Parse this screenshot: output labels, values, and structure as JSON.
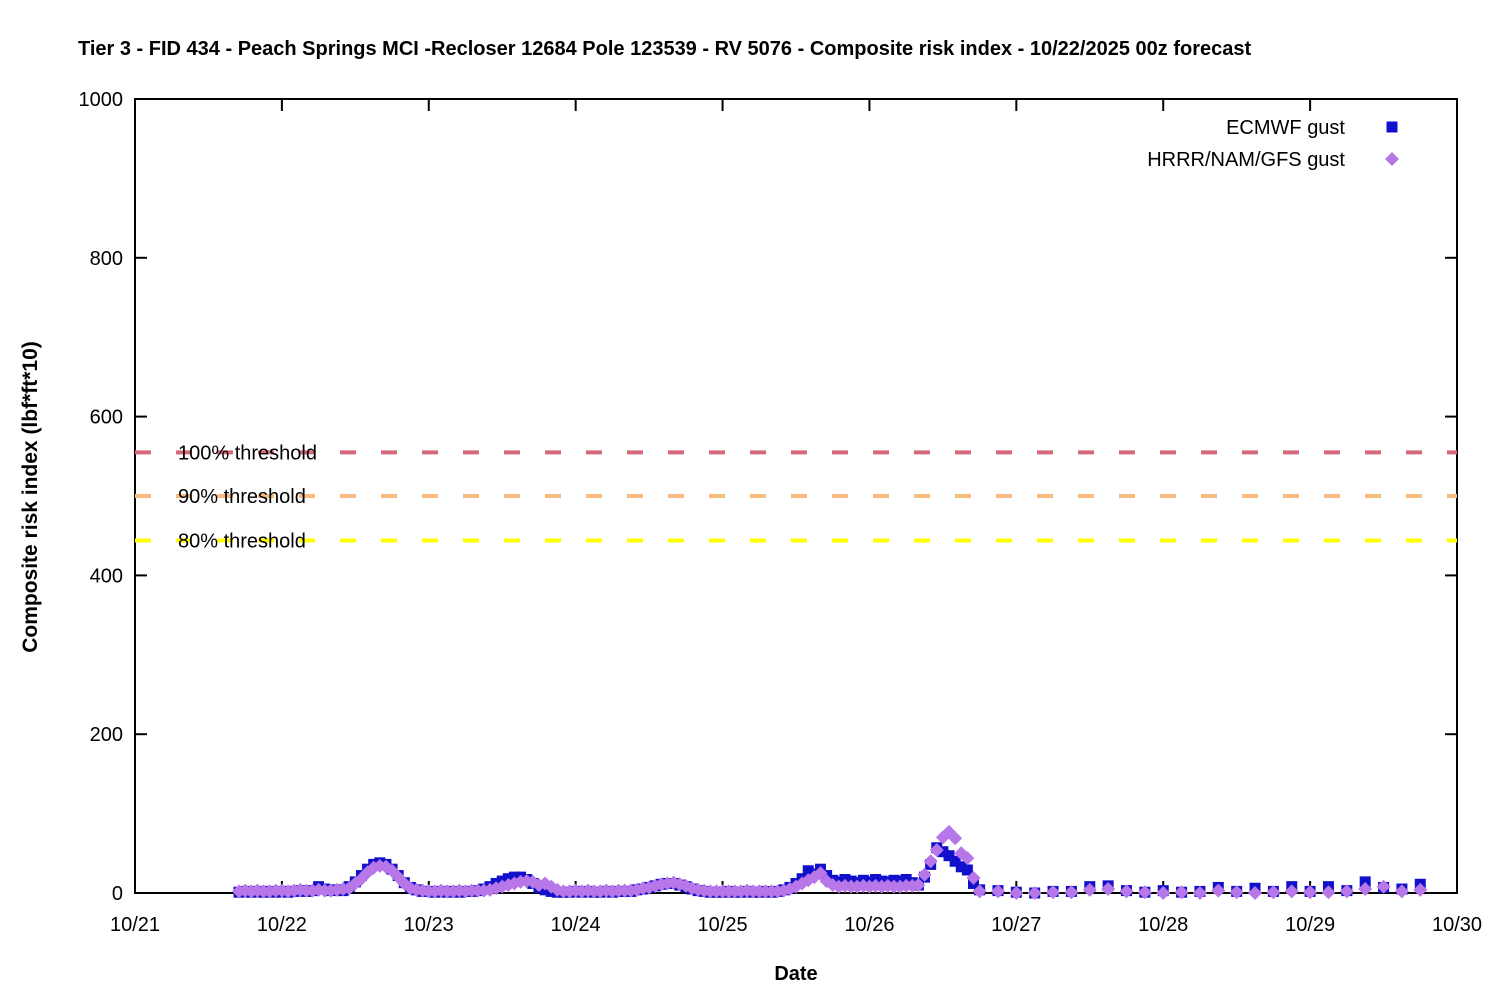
{
  "title": "Tier 3 - FID 434 - Peach Springs MCI -Recloser 12684 Pole 123539 - RV 5076 - Composite risk index - 10/22/2025 00z forecast",
  "chart_data": {
    "type": "scatter",
    "title": "Tier 3 - FID 434 - Peach Springs MCI -Recloser 12684 Pole 123539 - RV 5076 - Composite risk index - 10/22/2025 00z forecast",
    "xlabel": "Date",
    "ylabel": "Composite risk index (lbf*ft*10)",
    "x_tick_labels": [
      "10/21",
      "10/22",
      "10/23",
      "10/24",
      "10/25",
      "10/26",
      "10/27",
      "10/28",
      "10/29",
      "10/30"
    ],
    "x_range_days": 9,
    "x_unit": "point x = hours after 10/21 00:00",
    "ylim": [
      0,
      1000
    ],
    "y_ticks": [
      0,
      200,
      400,
      600,
      800,
      1000
    ],
    "grid": "off",
    "legend_position": "top-right-inside",
    "thresholds": [
      {
        "label": "100% threshold",
        "value": 555,
        "color": "#d4697c"
      },
      {
        "label": "90% threshold",
        "value": 500,
        "color": "#f9bc80"
      },
      {
        "label": "80% threshold",
        "value": 444,
        "color": "#ffff00"
      }
    ],
    "series": [
      {
        "name": "ECMWF gust",
        "marker": "square",
        "color": "#1111cc",
        "points": [
          [
            17,
            1
          ],
          [
            18,
            2
          ],
          [
            19,
            1
          ],
          [
            20,
            2
          ],
          [
            21,
            1
          ],
          [
            22,
            2
          ],
          [
            23,
            1
          ],
          [
            24,
            2
          ],
          [
            25,
            1
          ],
          [
            26,
            2
          ],
          [
            27,
            3
          ],
          [
            28,
            2
          ],
          [
            29,
            3
          ],
          [
            30,
            8
          ],
          [
            31,
            5
          ],
          [
            32,
            3
          ],
          [
            33,
            4
          ],
          [
            34,
            3
          ],
          [
            35,
            8
          ],
          [
            36,
            14
          ],
          [
            37,
            22
          ],
          [
            38,
            30
          ],
          [
            39,
            36
          ],
          [
            40,
            38
          ],
          [
            41,
            36
          ],
          [
            42,
            30
          ],
          [
            43,
            22
          ],
          [
            44,
            13
          ],
          [
            45,
            7
          ],
          [
            46,
            4
          ],
          [
            47,
            2
          ],
          [
            48,
            2
          ],
          [
            49,
            1
          ],
          [
            50,
            2
          ],
          [
            51,
            1
          ],
          [
            52,
            2
          ],
          [
            53,
            1
          ],
          [
            54,
            2
          ],
          [
            55,
            2
          ],
          [
            56,
            3
          ],
          [
            57,
            5
          ],
          [
            58,
            8
          ],
          [
            59,
            12
          ],
          [
            60,
            15
          ],
          [
            61,
            18
          ],
          [
            62,
            20
          ],
          [
            63,
            20
          ],
          [
            64,
            17
          ],
          [
            65,
            12
          ],
          [
            66,
            7
          ],
          [
            67,
            4
          ],
          [
            68,
            2
          ],
          [
            69,
            1
          ],
          [
            70,
            1
          ],
          [
            71,
            1
          ],
          [
            72,
            2
          ],
          [
            73,
            1
          ],
          [
            74,
            2
          ],
          [
            75,
            1
          ],
          [
            76,
            1
          ],
          [
            77,
            2
          ],
          [
            78,
            1
          ],
          [
            79,
            2
          ],
          [
            80,
            2
          ],
          [
            81,
            2
          ],
          [
            82,
            4
          ],
          [
            83,
            5
          ],
          [
            84,
            7
          ],
          [
            85,
            9
          ],
          [
            86,
            11
          ],
          [
            87,
            12
          ],
          [
            88,
            12
          ],
          [
            89,
            10
          ],
          [
            90,
            8
          ],
          [
            91,
            5
          ],
          [
            92,
            3
          ],
          [
            93,
            2
          ],
          [
            94,
            1
          ],
          [
            95,
            1
          ],
          [
            96,
            1
          ],
          [
            97,
            2
          ],
          [
            98,
            1
          ],
          [
            99,
            1
          ],
          [
            100,
            2
          ],
          [
            101,
            1
          ],
          [
            102,
            1
          ],
          [
            103,
            2
          ],
          [
            104,
            1
          ],
          [
            105,
            2
          ],
          [
            106,
            4
          ],
          [
            107,
            7
          ],
          [
            108,
            12
          ],
          [
            109,
            18
          ],
          [
            110,
            28
          ],
          [
            111,
            24
          ],
          [
            112,
            30
          ],
          [
            113,
            22
          ],
          [
            114,
            16
          ],
          [
            115,
            14
          ],
          [
            116,
            17
          ],
          [
            117,
            15
          ],
          [
            118,
            13
          ],
          [
            119,
            16
          ],
          [
            120,
            14
          ],
          [
            121,
            17
          ],
          [
            122,
            15
          ],
          [
            123,
            14
          ],
          [
            124,
            16
          ],
          [
            125,
            15
          ],
          [
            126,
            17
          ],
          [
            127,
            13
          ],
          [
            128,
            10
          ],
          [
            129,
            20
          ],
          [
            130,
            36
          ],
          [
            131,
            57
          ],
          [
            132,
            52
          ],
          [
            133,
            47
          ],
          [
            134,
            40
          ],
          [
            135,
            33
          ],
          [
            136,
            29
          ],
          [
            137,
            12
          ],
          [
            138,
            4
          ],
          [
            141,
            3
          ],
          [
            144,
            1
          ],
          [
            147,
            0
          ],
          [
            150,
            2
          ],
          [
            153,
            2
          ],
          [
            156,
            8
          ],
          [
            159,
            9
          ],
          [
            162,
            3
          ],
          [
            165,
            1
          ],
          [
            168,
            3
          ],
          [
            171,
            1
          ],
          [
            174,
            2
          ],
          [
            177,
            7
          ],
          [
            180,
            2
          ],
          [
            183,
            6
          ],
          [
            186,
            2
          ],
          [
            189,
            8
          ],
          [
            192,
            2
          ],
          [
            195,
            8
          ],
          [
            198,
            3
          ],
          [
            201,
            14
          ],
          [
            204,
            7
          ],
          [
            207,
            5
          ],
          [
            210,
            11
          ]
        ]
      },
      {
        "name": "HRRR/NAM/GFS gust",
        "marker": "diamond",
        "color": "#b877e8",
        "points": [
          [
            17,
            2
          ],
          [
            18,
            3
          ],
          [
            19,
            2
          ],
          [
            20,
            3
          ],
          [
            21,
            2
          ],
          [
            22,
            2
          ],
          [
            23,
            3
          ],
          [
            24,
            3
          ],
          [
            25,
            2
          ],
          [
            26,
            3
          ],
          [
            27,
            4
          ],
          [
            28,
            3
          ],
          [
            29,
            3
          ],
          [
            30,
            4
          ],
          [
            31,
            3
          ],
          [
            32,
            3
          ],
          [
            33,
            4
          ],
          [
            34,
            5
          ],
          [
            35,
            6
          ],
          [
            36,
            12
          ],
          [
            37,
            18
          ],
          [
            38,
            26
          ],
          [
            39,
            32
          ],
          [
            40,
            34
          ],
          [
            41,
            33
          ],
          [
            42,
            28
          ],
          [
            43,
            20
          ],
          [
            44,
            12
          ],
          [
            45,
            6
          ],
          [
            46,
            4
          ],
          [
            47,
            3
          ],
          [
            48,
            2
          ],
          [
            49,
            2
          ],
          [
            50,
            3
          ],
          [
            51,
            2
          ],
          [
            52,
            2
          ],
          [
            53,
            3
          ],
          [
            54,
            2
          ],
          [
            55,
            3
          ],
          [
            56,
            3
          ],
          [
            57,
            3
          ],
          [
            58,
            4
          ],
          [
            59,
            6
          ],
          [
            60,
            8
          ],
          [
            61,
            10
          ],
          [
            62,
            12
          ],
          [
            63,
            14
          ],
          [
            64,
            15
          ],
          [
            65,
            14
          ],
          [
            66,
            10
          ],
          [
            67,
            12
          ],
          [
            68,
            8
          ],
          [
            69,
            4
          ],
          [
            70,
            2
          ],
          [
            71,
            2
          ],
          [
            72,
            3
          ],
          [
            73,
            2
          ],
          [
            74,
            3
          ],
          [
            75,
            2
          ],
          [
            76,
            2
          ],
          [
            77,
            3
          ],
          [
            78,
            2
          ],
          [
            79,
            3
          ],
          [
            80,
            3
          ],
          [
            81,
            3
          ],
          [
            82,
            4
          ],
          [
            83,
            6
          ],
          [
            84,
            7
          ],
          [
            85,
            9
          ],
          [
            86,
            11
          ],
          [
            87,
            12
          ],
          [
            88,
            13
          ],
          [
            89,
            11
          ],
          [
            90,
            9
          ],
          [
            91,
            6
          ],
          [
            92,
            4
          ],
          [
            93,
            3
          ],
          [
            94,
            2
          ],
          [
            95,
            2
          ],
          [
            96,
            2
          ],
          [
            97,
            2
          ],
          [
            98,
            2
          ],
          [
            99,
            2
          ],
          [
            100,
            3
          ],
          [
            101,
            2
          ],
          [
            102,
            2
          ],
          [
            103,
            2
          ],
          [
            104,
            2
          ],
          [
            105,
            2
          ],
          [
            106,
            3
          ],
          [
            107,
            5
          ],
          [
            108,
            8
          ],
          [
            109,
            12
          ],
          [
            110,
            16
          ],
          [
            111,
            20
          ],
          [
            112,
            25
          ],
          [
            113,
            15
          ],
          [
            114,
            10
          ],
          [
            115,
            8
          ],
          [
            116,
            9
          ],
          [
            117,
            8
          ],
          [
            118,
            8
          ],
          [
            119,
            9
          ],
          [
            120,
            8
          ],
          [
            121,
            9
          ],
          [
            122,
            8
          ],
          [
            123,
            9
          ],
          [
            124,
            8
          ],
          [
            125,
            8
          ],
          [
            126,
            9
          ],
          [
            127,
            9
          ],
          [
            128,
            10
          ],
          [
            129,
            23
          ],
          [
            130,
            40
          ],
          [
            131,
            54
          ],
          [
            132,
            70
          ],
          [
            133,
            77
          ],
          [
            134,
            69
          ],
          [
            135,
            50
          ],
          [
            136,
            44
          ],
          [
            137,
            19
          ],
          [
            138,
            2
          ],
          [
            141,
            2
          ],
          [
            144,
            0
          ],
          [
            147,
            0
          ],
          [
            150,
            1
          ],
          [
            153,
            1
          ],
          [
            156,
            4
          ],
          [
            159,
            5
          ],
          [
            162,
            2
          ],
          [
            165,
            1
          ],
          [
            168,
            0
          ],
          [
            171,
            1
          ],
          [
            174,
            0
          ],
          [
            177,
            3
          ],
          [
            180,
            1
          ],
          [
            183,
            0
          ],
          [
            186,
            1
          ],
          [
            189,
            2
          ],
          [
            192,
            1
          ],
          [
            195,
            1
          ],
          [
            198,
            2
          ],
          [
            201,
            5
          ],
          [
            204,
            8
          ],
          [
            207,
            2
          ],
          [
            210,
            4
          ]
        ]
      }
    ]
  }
}
